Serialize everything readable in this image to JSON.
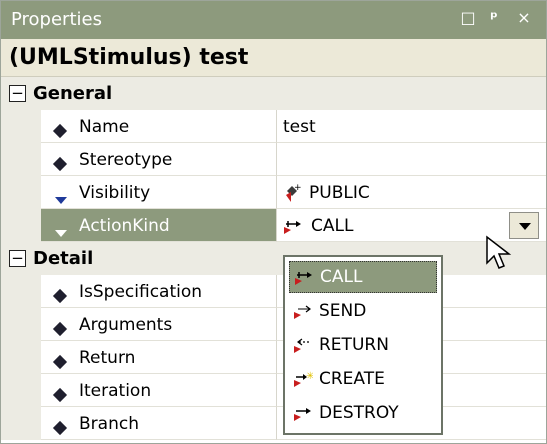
{
  "window": {
    "title": "Properties",
    "buttons": [
      {
        "icon": "maximize-icon",
        "glyph": "□"
      },
      {
        "icon": "pin-icon",
        "glyph": "ᵖ"
      },
      {
        "icon": "close-icon",
        "glyph": "×"
      }
    ]
  },
  "object_header": "(UMLStimulus) test",
  "categories": {
    "general": {
      "label": "General",
      "toggle": "⊟"
    },
    "detail": {
      "label": "Detail",
      "toggle": "⊟"
    }
  },
  "general_props": [
    {
      "name": "Name",
      "value": "test",
      "marker": "diamond"
    },
    {
      "name": "Stereotype",
      "value": "",
      "marker": "diamond"
    },
    {
      "name": "Visibility",
      "value": "PUBLIC",
      "marker": "triangle",
      "value_icon": "public-visibility-icon"
    },
    {
      "name": "ActionKind",
      "value": "CALL",
      "marker": "triangle",
      "value_icon": "call-action-icon",
      "selected": true
    }
  ],
  "detail_props": [
    {
      "name": "IsSpecification",
      "marker": "diamond"
    },
    {
      "name": "Arguments",
      "marker": "diamond"
    },
    {
      "name": "Return",
      "marker": "diamond"
    },
    {
      "name": "Iteration",
      "marker": "diamond"
    },
    {
      "name": "Branch",
      "marker": "diamond"
    }
  ],
  "dropdown": {
    "options": [
      "CALL",
      "SEND",
      "RETURN",
      "CREATE",
      "DESTROY"
    ],
    "selected": "CALL"
  },
  "colors": {
    "accent": "#8d9a7d",
    "category_bg": "#ecebe3",
    "icon_red": "#c81e1e"
  }
}
